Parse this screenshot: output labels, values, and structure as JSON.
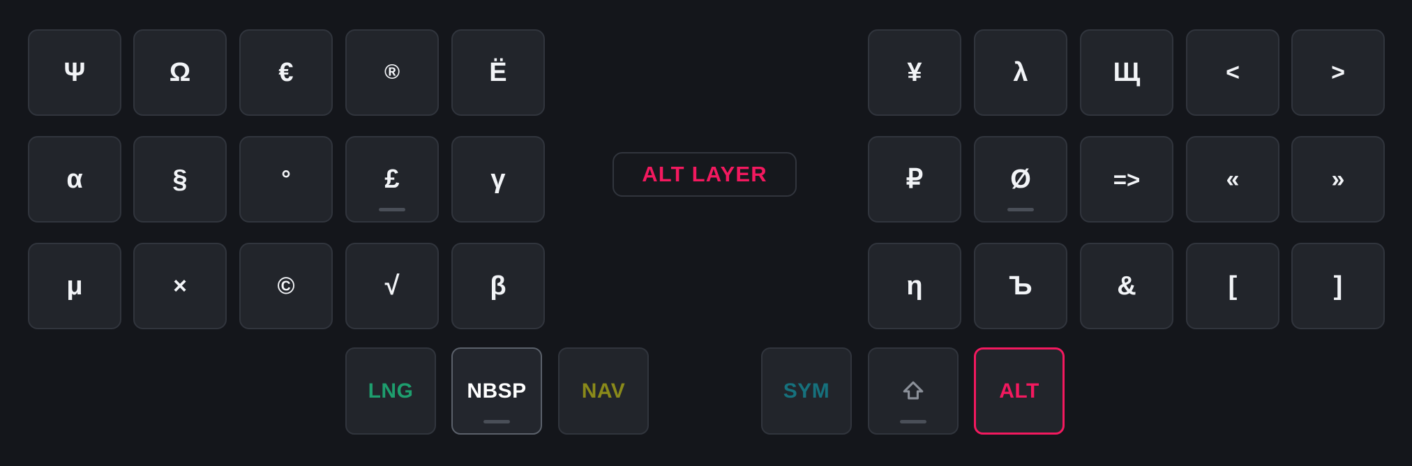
{
  "app": {
    "title": "Virtual Keyboard — ALT Layer",
    "background_color": "#14161b",
    "key_color": "#22252b",
    "key_border_color": "#31353d",
    "key_text_color": "#f2f4f7",
    "accent_color": "#f3195f"
  },
  "layer_badge": {
    "label": "ALT LAYER",
    "color": "#f3195f"
  },
  "left_half": {
    "rows": [
      {
        "row_index": 0,
        "keys": [
          {
            "label": "Ψ",
            "name": "key-psi",
            "marker": false,
            "highlight": false
          },
          {
            "label": "Ω",
            "name": "key-omega",
            "marker": false,
            "highlight": false
          },
          {
            "label": "€",
            "name": "key-euro",
            "marker": false,
            "highlight": false
          },
          {
            "label": "®",
            "name": "key-registered",
            "marker": false,
            "highlight": false
          },
          {
            "label": "Ё",
            "name": "key-cyrillic-yo",
            "marker": false,
            "highlight": false
          }
        ]
      },
      {
        "row_index": 1,
        "keys": [
          {
            "label": "α",
            "name": "key-alpha",
            "marker": false,
            "highlight": false
          },
          {
            "label": "§",
            "name": "key-section",
            "marker": false,
            "highlight": false
          },
          {
            "label": "°",
            "name": "key-degree",
            "marker": false,
            "highlight": false
          },
          {
            "label": "£",
            "name": "key-pound",
            "marker": true,
            "highlight": false
          },
          {
            "label": "γ",
            "name": "key-gamma",
            "marker": false,
            "highlight": false
          }
        ]
      },
      {
        "row_index": 2,
        "keys": [
          {
            "label": "μ",
            "name": "key-mu",
            "marker": false,
            "highlight": false
          },
          {
            "label": "×",
            "name": "key-multiply",
            "marker": false,
            "highlight": false
          },
          {
            "label": "©",
            "name": "key-copyright",
            "marker": false,
            "highlight": false
          },
          {
            "label": "√",
            "name": "key-sqrt",
            "marker": false,
            "highlight": false
          },
          {
            "label": "β",
            "name": "key-beta",
            "marker": false,
            "highlight": false
          }
        ]
      }
    ],
    "thumb_keys": [
      {
        "label": "LNG",
        "name": "key-lng",
        "color": "#1e9e6e",
        "marker": false,
        "highlight": false,
        "accent": false
      },
      {
        "label": "NBSP",
        "name": "key-nbsp",
        "color": "#ffffff",
        "marker": true,
        "highlight": true,
        "accent": false
      },
      {
        "label": "NAV",
        "name": "key-nav",
        "color": "#8a8a1a",
        "marker": false,
        "highlight": false,
        "accent": false
      }
    ]
  },
  "right_half": {
    "rows": [
      {
        "row_index": 0,
        "keys": [
          {
            "label": "¥",
            "name": "key-yen",
            "marker": false,
            "highlight": false
          },
          {
            "label": "λ",
            "name": "key-lambda",
            "marker": false,
            "highlight": false
          },
          {
            "label": "Щ",
            "name": "key-cyrillic-shcha",
            "marker": false,
            "highlight": false
          },
          {
            "label": "<",
            "name": "key-less-than",
            "marker": false,
            "highlight": false
          },
          {
            "label": ">",
            "name": "key-greater-than",
            "marker": false,
            "highlight": false
          }
        ]
      },
      {
        "row_index": 1,
        "keys": [
          {
            "label": "₽",
            "name": "key-ruble",
            "marker": false,
            "highlight": false
          },
          {
            "label": "Ø",
            "name": "key-o-slash",
            "marker": true,
            "highlight": false
          },
          {
            "label": "=>",
            "name": "key-fat-arrow",
            "marker": false,
            "highlight": false
          },
          {
            "label": "«",
            "name": "key-guillemet-left",
            "marker": false,
            "highlight": false
          },
          {
            "label": "»",
            "name": "key-guillemet-right",
            "marker": false,
            "highlight": false
          }
        ]
      },
      {
        "row_index": 2,
        "keys": [
          {
            "label": "η",
            "name": "key-eta",
            "marker": false,
            "highlight": false
          },
          {
            "label": "Ъ",
            "name": "key-cyrillic-hard-sign",
            "marker": false,
            "highlight": false
          },
          {
            "label": "&",
            "name": "key-ampersand",
            "marker": false,
            "highlight": false
          },
          {
            "label": "[",
            "name": "key-bracket-left",
            "marker": false,
            "highlight": false
          },
          {
            "label": "]",
            "name": "key-bracket-right",
            "marker": false,
            "highlight": false
          }
        ]
      }
    ],
    "thumb_keys": [
      {
        "label": "SYM",
        "name": "key-sym",
        "color": "#16717d",
        "marker": false,
        "highlight": false,
        "accent": false,
        "icon": null
      },
      {
        "label": "",
        "name": "key-shift",
        "color": "#8b9099",
        "marker": true,
        "highlight": false,
        "accent": false,
        "icon": "shift-up-arrow-icon"
      },
      {
        "label": "ALT",
        "name": "key-alt",
        "color": "#f3195f",
        "marker": false,
        "highlight": false,
        "accent": true,
        "icon": null
      }
    ]
  }
}
